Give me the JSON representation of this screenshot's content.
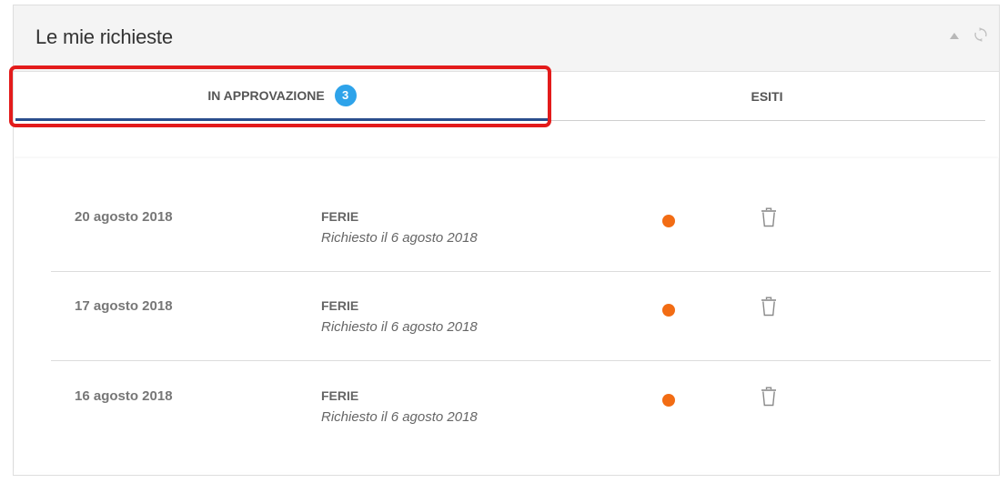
{
  "widget": {
    "title": "Le mie richieste",
    "icons": {
      "collapse": "collapse-up-icon",
      "refresh": "refresh-icon"
    }
  },
  "tabs": [
    {
      "label": "IN APPROVAZIONE",
      "badge": "3",
      "active": true
    },
    {
      "label": "ESITI",
      "active": false
    }
  ],
  "colors": {
    "badge": "#2ea3ea",
    "active_tab_underline": "#2a4d8c",
    "status_pending": "#f26c14",
    "highlight_box": "#e31b1b"
  },
  "requests": [
    {
      "date": "20 agosto 2018",
      "type": "FERIE",
      "requested": "Richiesto il 6 agosto 2018",
      "status": "pending",
      "action_icon": "trash-icon"
    },
    {
      "date": "17 agosto 2018",
      "type": "FERIE",
      "requested": "Richiesto il 6 agosto 2018",
      "status": "pending",
      "action_icon": "trash-icon"
    },
    {
      "date": "16 agosto 2018",
      "type": "FERIE",
      "requested": "Richiesto il 6 agosto 2018",
      "status": "pending",
      "action_icon": "trash-icon"
    }
  ]
}
